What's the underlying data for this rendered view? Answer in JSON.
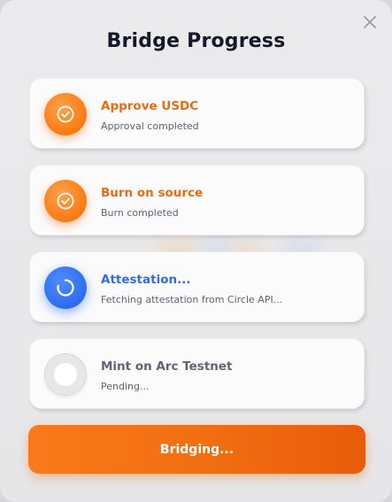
{
  "dialog": {
    "title": "Bridge Progress",
    "close_icon": "close-icon"
  },
  "steps": [
    {
      "title": "Approve USDC",
      "subtitle": "Approval completed",
      "status": "completed",
      "icon": "check-circle-icon",
      "accent": "#ea6c12"
    },
    {
      "title": "Burn on source",
      "subtitle": "Burn completed",
      "status": "completed",
      "icon": "check-circle-icon",
      "accent": "#ea6c12"
    },
    {
      "title": "Attestation...",
      "subtitle": "Fetching attestation from Circle API...",
      "status": "in-progress",
      "icon": "spinner-icon",
      "accent": "#2f6ce6"
    },
    {
      "title": "Mint on Arc Testnet",
      "subtitle": "Pending...",
      "status": "pending",
      "icon": "pending-circle-icon",
      "accent": "#5f6473"
    }
  ],
  "action": {
    "label": "Bridging..."
  },
  "colors": {
    "orange": "#f97316",
    "blue": "#2f6ce6",
    "title": "#15182b"
  }
}
